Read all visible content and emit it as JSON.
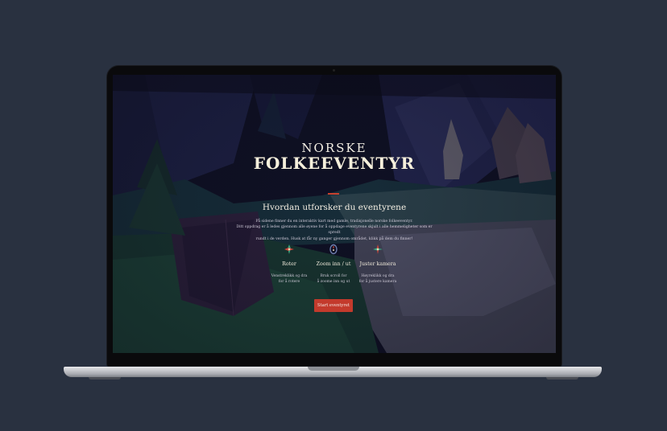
{
  "hero": {
    "title_top": "NORSKE",
    "title_main": "FOLKEEVENTYR"
  },
  "section": {
    "heading": "Hvordan utforsker du eventyrene",
    "intro_lines": [
      "På sidene finner du en interaktiv kart med gamle, tradisjonelle norske folkeeventyr.",
      "Ditt oppdrag er å ledes gjennom alle øyene for å oppdage eventyrene skjult i alle hemmeligheter som er spredt",
      "rundt i de verden. Husk at får ny ganger gjennom området, klikk på dem du finner!"
    ]
  },
  "features": [
    {
      "icon": "rotate-icon",
      "title": "Roter",
      "desc_lines": [
        "Venstreklikk og dra",
        "for å rotere"
      ]
    },
    {
      "icon": "zoom-icon",
      "title": "Zoom inn / ut",
      "desc_lines": [
        "Bruk scroll for",
        "å zoome inn og ut"
      ]
    },
    {
      "icon": "move-camera-icon",
      "title": "Juster kamera",
      "desc_lines": [
        "Høyreklikk og dra",
        "for å justere kamera"
      ]
    }
  ],
  "cta": {
    "label": "Start eventyret"
  },
  "colors": {
    "background": "#293140",
    "accent": "#c33a2c",
    "title": "#f6f0dc"
  }
}
